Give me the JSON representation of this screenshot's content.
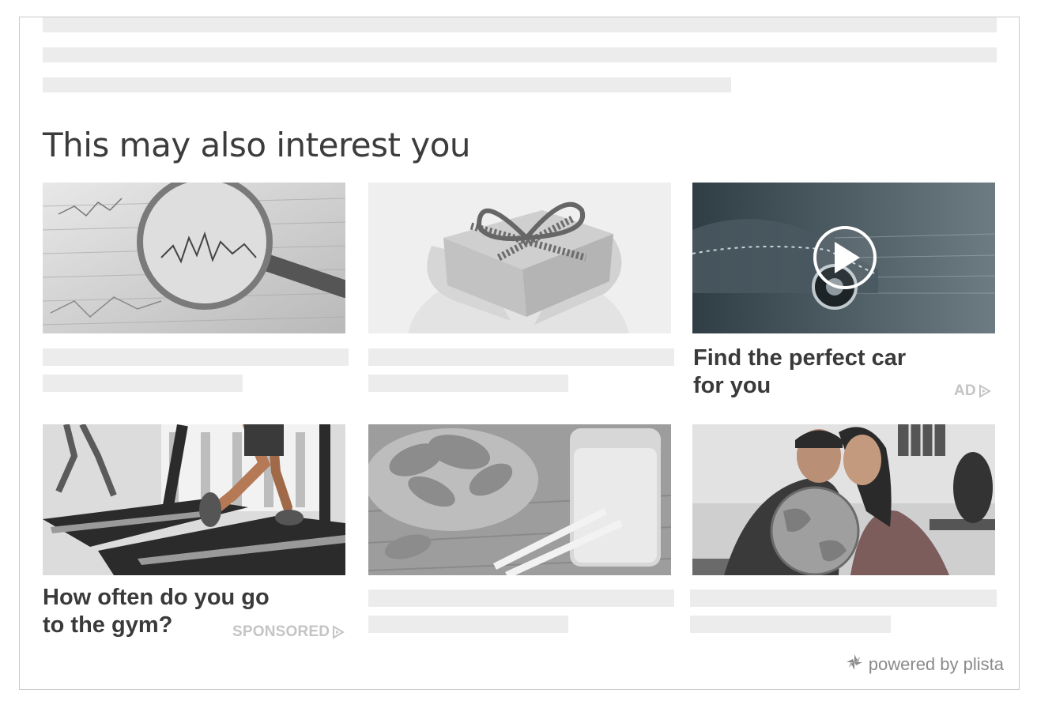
{
  "section": {
    "heading": "This may also interest you"
  },
  "cards": [
    {
      "id": "finance",
      "image": "magnifying-glass-over-stock-charts"
    },
    {
      "id": "gift",
      "image": "hands-holding-gift-box"
    },
    {
      "id": "car",
      "image": "sports-car-video-thumbnail",
      "title": "Find the perfect car for you",
      "label": "AD"
    },
    {
      "id": "gym",
      "image": "people-running-on-treadmills",
      "title": "How often do you go to the gym?",
      "label": "SPONSORED"
    },
    {
      "id": "food",
      "image": "spinach-and-smoothie"
    },
    {
      "id": "travel",
      "image": "couple-with-globe"
    }
  ],
  "footer": {
    "powered_by": "powered by plista"
  },
  "colors": {
    "placeholder": "#ececec",
    "heading": "#3c3c3c",
    "label": "#c4c4c4",
    "frame": "#c9c9c9"
  },
  "icons": [
    "play-icon",
    "ad-choices-icon",
    "plista-logo-icon"
  ]
}
